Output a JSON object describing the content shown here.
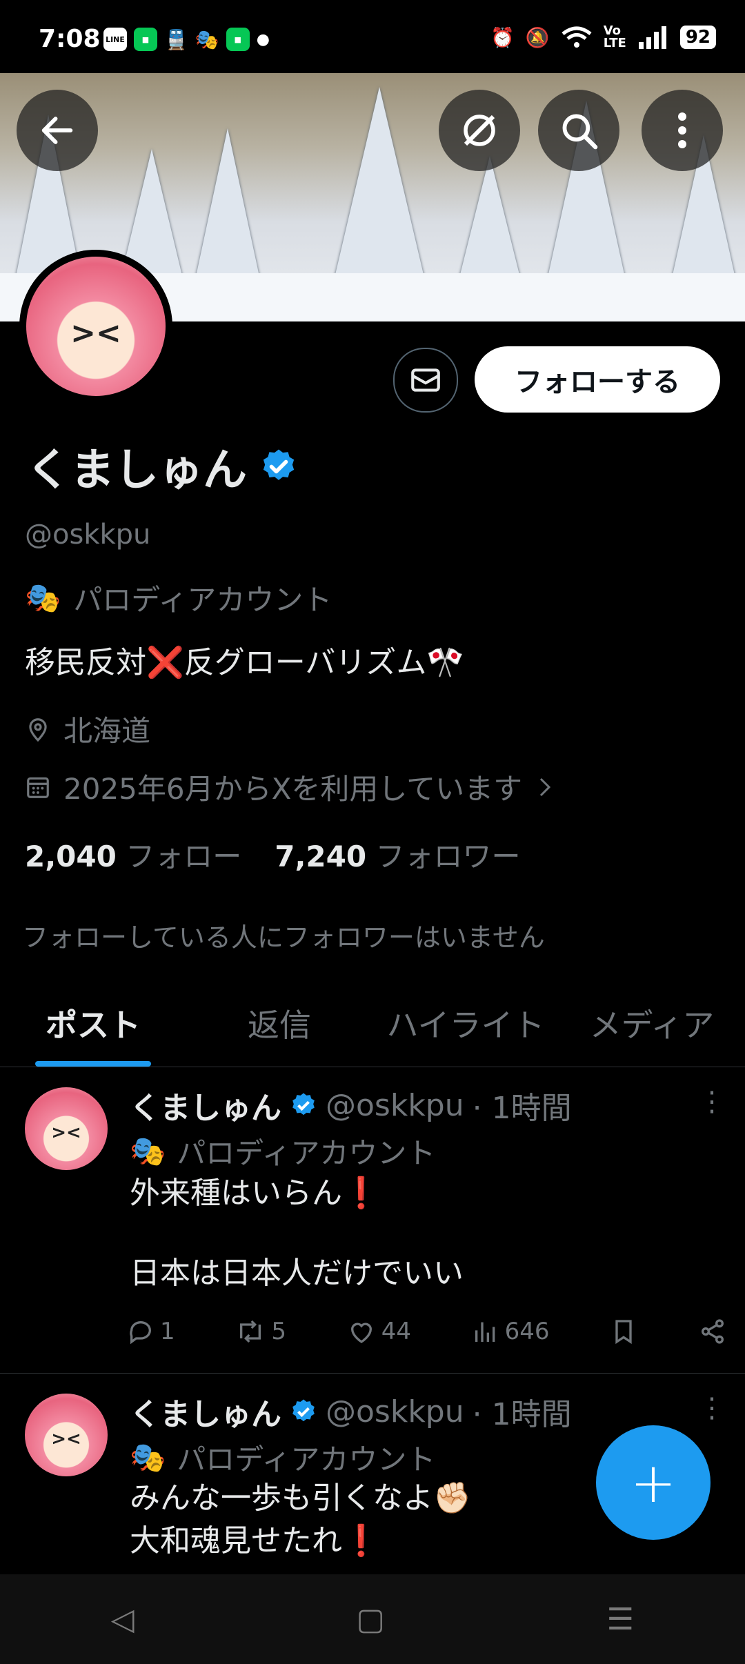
{
  "status_bar": {
    "time": "7:08",
    "battery": "92",
    "left_icons": [
      "LINE",
      "app",
      "train",
      "mask",
      "app",
      "dot"
    ],
    "right_icons": [
      "alarm-icon",
      "mute-icon",
      "wifi-icon",
      "volte-icon",
      "signal-icon"
    ]
  },
  "header": {
    "back_icon": "arrow-left-icon",
    "grok_icon": "grok-icon",
    "search_icon": "search-icon",
    "more_icon": "more-vertical-icon"
  },
  "profile": {
    "name": "くましゅん",
    "handle": "@oskkpu",
    "parody_label": "パロディアカウント",
    "bio": "移民反対❌反グローバリズム🎌",
    "location": "北海道",
    "joined": "2025年6月からXを利用しています",
    "following_count": "2,040",
    "following_label": "フォロー",
    "followers_count": "7,240",
    "followers_label": "フォロワー",
    "no_mutuals": "フォローしている人にフォロワーはいません",
    "follow_button": "フォローする",
    "verified_color": "#1d9bf0"
  },
  "tabs": [
    {
      "label": "ポスト",
      "active": true
    },
    {
      "label": "返信",
      "active": false
    },
    {
      "label": "ハイライト",
      "active": false
    },
    {
      "label": "メディア",
      "active": false
    }
  ],
  "posts": [
    {
      "name": "くましゅん",
      "handle": "@oskkpu",
      "time": "· 1時間",
      "parody": "パロディアカウント",
      "line1": "外来種はいらん❗",
      "line2": "日本は日本人だけでいい",
      "replies": "1",
      "reposts": "5",
      "likes": "44",
      "views": "646"
    },
    {
      "name": "くましゅん",
      "handle": "@oskkpu",
      "time": "· 1時間",
      "parody": "パロディアカウント",
      "line1": "みんな一歩も引くなよ✊🏻",
      "line2": "大和魂見せたれ❗"
    }
  ],
  "fab_label": "+",
  "accent": "#1d9bf0"
}
